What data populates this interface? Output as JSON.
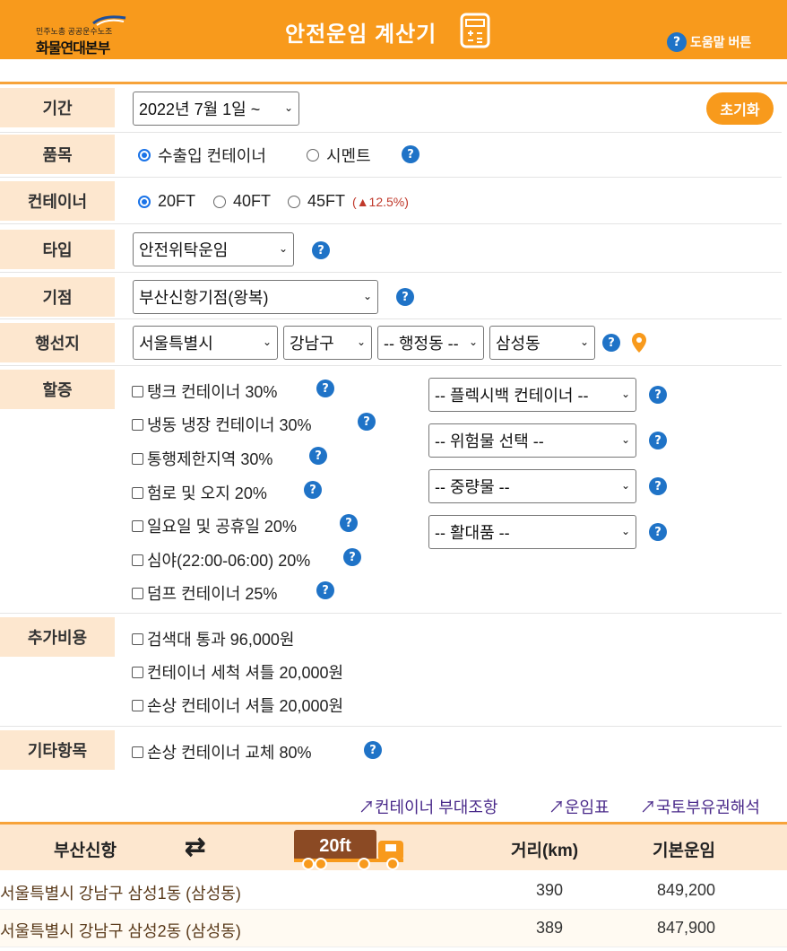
{
  "header": {
    "logo_sub": "민주노총 공공운수노조",
    "logo_main": "화물연대본부",
    "title": "안전운임 계산기",
    "help_label": "도움말 버튼"
  },
  "period": {
    "label": "기간",
    "value": "2022년 7월 1일 ~",
    "reset": "초기화"
  },
  "item": {
    "label": "품목",
    "options": [
      "수출입 컨테이너",
      "시멘트"
    ],
    "selected": "수출입 컨테이너"
  },
  "container": {
    "label": "컨테이너",
    "options": [
      "20FT",
      "40FT",
      "45FT"
    ],
    "selected": "20FT",
    "note_arrow": "▲",
    "note": "12.5%)",
    "note_open": "("
  },
  "type": {
    "label": "타입",
    "value": "안전위탁운임"
  },
  "origin": {
    "label": "기점",
    "value": "부산신항기점(왕복)"
  },
  "destination": {
    "label": "행선지",
    "city": "서울특별시",
    "district": "강남구",
    "admin": "-- 행정동 --",
    "dong": "삼성동"
  },
  "surcharge": {
    "label": "할증",
    "checks": [
      "탱크 컨테이너 30%",
      "냉동 냉장 컨테이너 30%",
      "통행제한지역 30%",
      "험로 및 오지 20%",
      "일요일 및 공휴일 20%",
      "심야(22:00-06:00) 20%",
      "덤프 컨테이너 25%"
    ],
    "selects": [
      "-- 플렉시백 컨테이너 --",
      "-- 위험물 선택 --",
      "-- 중량물 --",
      "-- 활대품 --"
    ]
  },
  "extra": {
    "label": "추가비용",
    "checks": [
      "검색대 통과 96,000원",
      "컨테이너 세척 셔틀 20,000원",
      "손상 컨테이너 셔틀 20,000원"
    ]
  },
  "other": {
    "label": "기타항목",
    "checks": [
      "손상 컨테이너 교체 80%"
    ]
  },
  "links": [
    "↗컨테이너 부대조항",
    "↗운임표",
    "↗국토부유권해석"
  ],
  "result": {
    "origin": "부산신항",
    "swap_icon": "⇄",
    "truck_label": "20ft",
    "distance_header": "거리(km)",
    "fare_header": "기본운임",
    "rows": [
      {
        "place": "서울특별시 강남구 삼성1동 (삼성동)",
        "distance": "390",
        "fare": "849,200"
      },
      {
        "place": "서울특별시 강남구 삼성2동 (삼성동)",
        "distance": "389",
        "fare": "847,900"
      }
    ]
  },
  "help_glyph": "?",
  "chev_glyph": "⌄",
  "colors": {
    "accent": "#f89a1c",
    "label_bg": "#fde7cf",
    "help": "#1f73c7",
    "radio": "#1a73e8"
  }
}
